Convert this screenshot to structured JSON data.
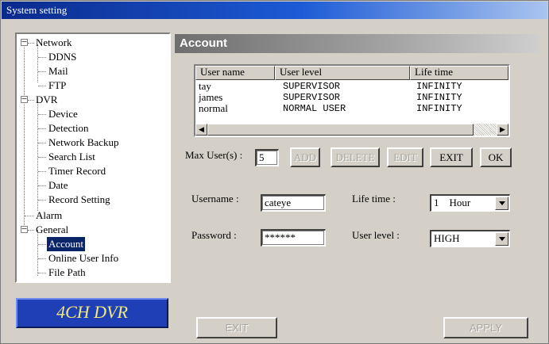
{
  "window": {
    "title": "System setting"
  },
  "tree": {
    "network": {
      "label": "Network",
      "children": [
        "DDNS",
        "Mail",
        "FTP"
      ]
    },
    "dvr": {
      "label": "DVR",
      "children": [
        "Device",
        "Detection",
        "Network Backup",
        "Search List",
        "Timer Record",
        "Date",
        "Record Setting"
      ]
    },
    "alarm": {
      "label": "Alarm"
    },
    "general": {
      "label": "General",
      "children": [
        "Account",
        "Online User Info",
        "File Path"
      ]
    },
    "selected": "Account"
  },
  "brand": {
    "text": "4CH DVR"
  },
  "panel": {
    "title": "Account"
  },
  "users_table": {
    "columns": [
      "User name",
      "User level",
      "Life time"
    ],
    "rows": [
      [
        "tay",
        "SUPERVISOR",
        "INFINITY"
      ],
      [
        "james",
        "SUPERVISOR",
        "INFINITY"
      ],
      [
        "normal",
        "NORMAL USER",
        "INFINITY"
      ]
    ]
  },
  "max_users": {
    "label": "Max User(s) :",
    "value": "5"
  },
  "actions": {
    "add": "ADD",
    "delete": "DELETE",
    "edit": "EDIT",
    "exit": "EXIT",
    "ok": "OK"
  },
  "form": {
    "username_label": "Username :",
    "username_value": "cateye",
    "password_label": "Password :",
    "password_value": "******",
    "lifetime_label": "Life time :",
    "lifetime_value": "1    Hour",
    "userlevel_label": "User level :",
    "userlevel_value": "HIGH"
  },
  "footer": {
    "exit": "EXIT",
    "apply": "APPLY"
  }
}
